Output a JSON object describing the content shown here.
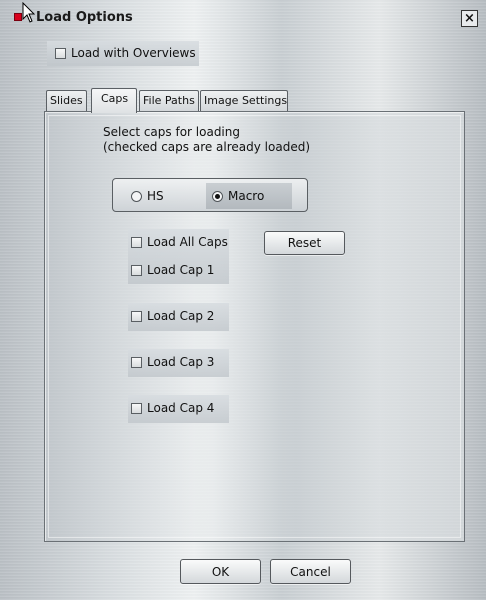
{
  "window": {
    "title": "Load Options",
    "close_glyph": "×"
  },
  "top": {
    "load_with_overviews_label": "Load with Overviews",
    "load_with_overviews_checked": false
  },
  "tabs": [
    {
      "label": "Slides",
      "active": false
    },
    {
      "label": "Caps",
      "active": true
    },
    {
      "label": "File Paths",
      "active": false
    },
    {
      "label": "Image Settings",
      "active": false
    }
  ],
  "caps": {
    "description_line1": "Select caps for loading",
    "description_line2": "(checked caps are already loaded)",
    "mode_options": [
      {
        "label": "HS",
        "selected": false
      },
      {
        "label": "Macro",
        "selected": true
      }
    ],
    "checkboxes": [
      {
        "label": "Load All Caps",
        "checked": false
      },
      {
        "label": "Load Cap 1",
        "checked": false
      },
      {
        "label": "Load Cap 2",
        "checked": false
      },
      {
        "label": "Load Cap 3",
        "checked": false
      },
      {
        "label": "Load Cap 4",
        "checked": false
      }
    ],
    "reset_label": "Reset"
  },
  "footer": {
    "ok_label": "OK",
    "cancel_label": "Cancel"
  }
}
